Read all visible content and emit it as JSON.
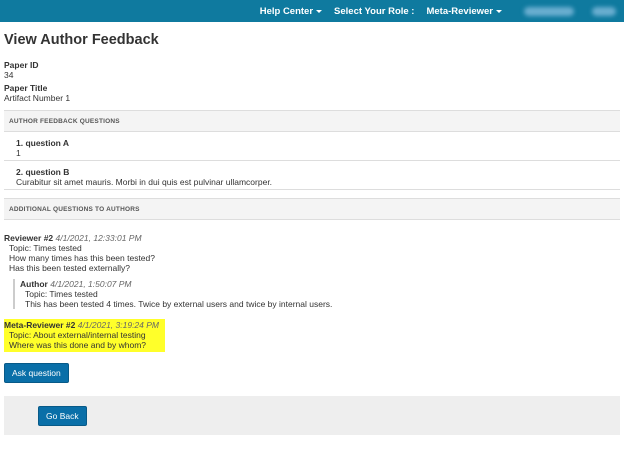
{
  "nav": {
    "help_center": "Help Center",
    "select_role": "Select Your Role :",
    "role": "Meta-Reviewer"
  },
  "page": {
    "title": "View Author Feedback",
    "paper_id_label": "Paper ID",
    "paper_id": "34",
    "paper_title_label": "Paper Title",
    "paper_title": "Artifact Number 1"
  },
  "feedback_section": {
    "header": "AUTHOR FEEDBACK QUESTIONS",
    "questions": [
      {
        "title": "1. question A",
        "answer": "1"
      },
      {
        "title": "2. question B",
        "answer": "Curabitur sit amet mauris. Morbi in dui quis est pulvinar ullamcorper."
      }
    ]
  },
  "additional_section": {
    "header": "ADDITIONAL QUESTIONS TO AUTHORS",
    "reviewer": {
      "name": "Reviewer #2",
      "timestamp": "4/1/2021, 12:33:01 PM",
      "topic": "Topic: Times tested",
      "lines": [
        "How many times has this been tested?",
        "Has this been tested externally?"
      ]
    },
    "author_reply": {
      "name": "Author",
      "timestamp": "4/1/2021, 1:50:07 PM",
      "topic": "Topic: Times tested",
      "text": "This has been tested 4 times. Twice by external users and twice by internal users."
    },
    "meta_reviewer": {
      "name": "Meta-Reviewer #2",
      "timestamp": "4/1/2021, 3:19:24 PM",
      "topic": "Topic: About external/internal testing",
      "text": "Where was this done and by whom?"
    }
  },
  "buttons": {
    "ask_question": "Ask question",
    "go_back": "Go Back"
  },
  "colors": {
    "topbar": "#0f7a9f",
    "button": "#0a6fa8",
    "highlight": "#ffff2a"
  }
}
